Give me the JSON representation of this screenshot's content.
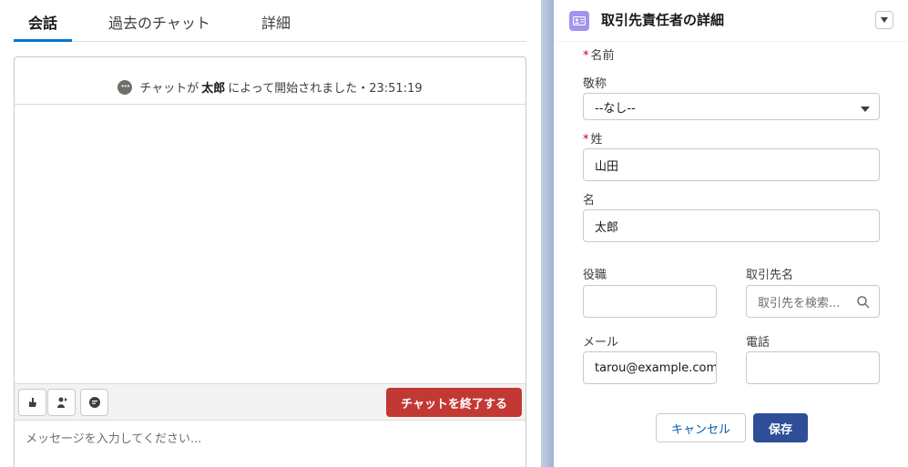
{
  "tabs": [
    {
      "label": "会話"
    },
    {
      "label": "過去のチャット"
    },
    {
      "label": "詳細"
    }
  ],
  "chat": {
    "started_prefix": "チャットが",
    "started_user": "太郎",
    "started_suffix": "によって開始されました・23:51:19",
    "end_button": "チャットを終了する",
    "message_placeholder": "メッセージを入力してください..."
  },
  "toolbar_icons": [
    "raise-hand-icon",
    "transfer-icon",
    "quick-text-icon"
  ],
  "detail": {
    "title": "取引先責任者の詳細",
    "fields": {
      "name_section_label": "名前",
      "salutation_label": "敬称",
      "salutation_value": "--なし--",
      "last_name_label": "姓",
      "last_name_value": "山田",
      "first_name_label": "名",
      "first_name_value": "太郎",
      "title_label": "役職",
      "title_value": "",
      "account_label": "取引先名",
      "account_placeholder": "取引先を検索...",
      "email_label": "メール",
      "email_value": "tarou@example.com",
      "phone_label": "電話",
      "phone_value": ""
    },
    "cancel_label": "キャンセル",
    "save_label": "保存"
  },
  "colors": {
    "accent": "#0176d3",
    "end_chat": "#c23934",
    "save": "#2e4e98",
    "contact_icon": "#a094ed",
    "required": "#ba0517"
  }
}
